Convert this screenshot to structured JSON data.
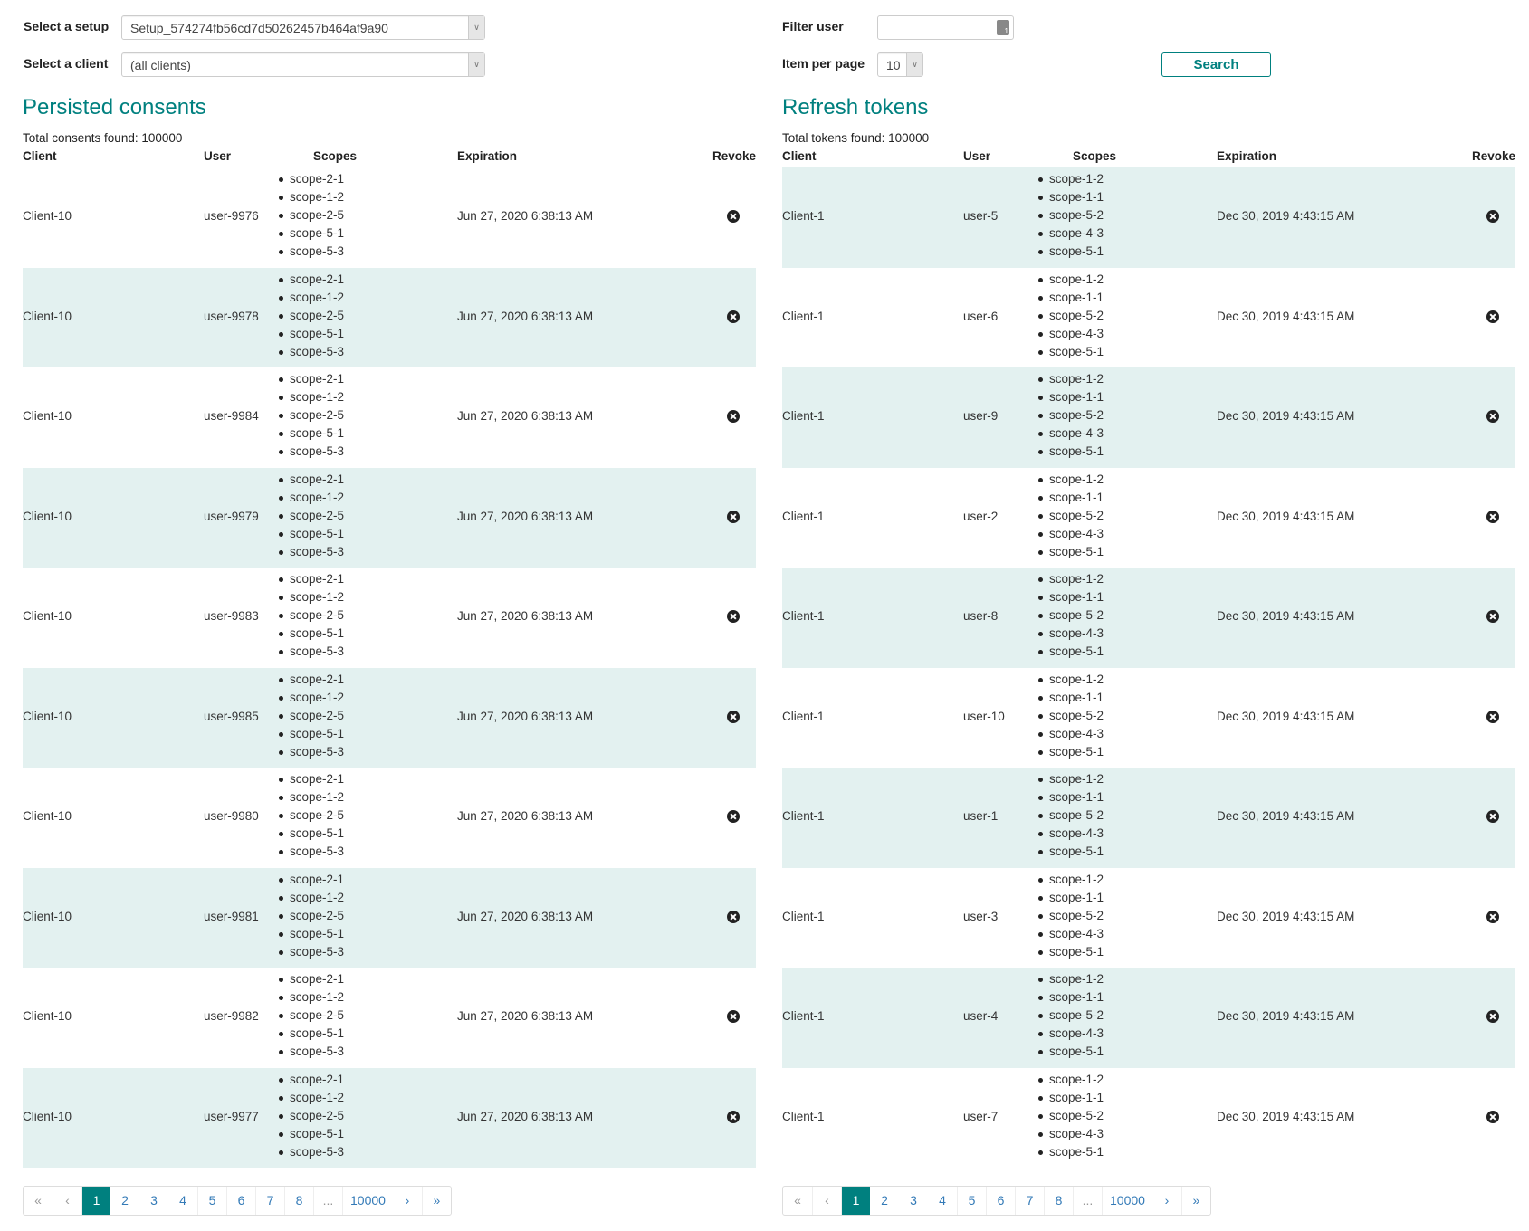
{
  "controls": {
    "setup_label": "Select a setup",
    "setup_value": "Setup_574274fb56cd7d50262457b464af9a90",
    "client_label": "Select a client",
    "client_value": "(all clients)",
    "filter_user_label": "Filter user",
    "filter_user_value": "",
    "item_per_page_label": "Item per page",
    "item_per_page_value": "10",
    "search_label": "Search"
  },
  "colors": {
    "accent": "#00807f",
    "row_shade": "#e3f1f0"
  },
  "consents": {
    "title": "Persisted consents",
    "total": "Total consents found: 100000",
    "headers": {
      "client": "Client",
      "user": "User",
      "scopes": "Scopes",
      "expiration": "Expiration",
      "revoke": "Revoke"
    },
    "rows": [
      {
        "client": "Client-10",
        "user": "user-9976",
        "scopes": [
          "scope-2-1",
          "scope-1-2",
          "scope-2-5",
          "scope-5-1",
          "scope-5-3"
        ],
        "expiration": "Jun 27, 2020 6:38:13 AM"
      },
      {
        "client": "Client-10",
        "user": "user-9978",
        "scopes": [
          "scope-2-1",
          "scope-1-2",
          "scope-2-5",
          "scope-5-1",
          "scope-5-3"
        ],
        "expiration": "Jun 27, 2020 6:38:13 AM"
      },
      {
        "client": "Client-10",
        "user": "user-9984",
        "scopes": [
          "scope-2-1",
          "scope-1-2",
          "scope-2-5",
          "scope-5-1",
          "scope-5-3"
        ],
        "expiration": "Jun 27, 2020 6:38:13 AM"
      },
      {
        "client": "Client-10",
        "user": "user-9979",
        "scopes": [
          "scope-2-1",
          "scope-1-2",
          "scope-2-5",
          "scope-5-1",
          "scope-5-3"
        ],
        "expiration": "Jun 27, 2020 6:38:13 AM"
      },
      {
        "client": "Client-10",
        "user": "user-9983",
        "scopes": [
          "scope-2-1",
          "scope-1-2",
          "scope-2-5",
          "scope-5-1",
          "scope-5-3"
        ],
        "expiration": "Jun 27, 2020 6:38:13 AM"
      },
      {
        "client": "Client-10",
        "user": "user-9985",
        "scopes": [
          "scope-2-1",
          "scope-1-2",
          "scope-2-5",
          "scope-5-1",
          "scope-5-3"
        ],
        "expiration": "Jun 27, 2020 6:38:13 AM"
      },
      {
        "client": "Client-10",
        "user": "user-9980",
        "scopes": [
          "scope-2-1",
          "scope-1-2",
          "scope-2-5",
          "scope-5-1",
          "scope-5-3"
        ],
        "expiration": "Jun 27, 2020 6:38:13 AM"
      },
      {
        "client": "Client-10",
        "user": "user-9981",
        "scopes": [
          "scope-2-1",
          "scope-1-2",
          "scope-2-5",
          "scope-5-1",
          "scope-5-3"
        ],
        "expiration": "Jun 27, 2020 6:38:13 AM"
      },
      {
        "client": "Client-10",
        "user": "user-9982",
        "scopes": [
          "scope-2-1",
          "scope-1-2",
          "scope-2-5",
          "scope-5-1",
          "scope-5-3"
        ],
        "expiration": "Jun 27, 2020 6:38:13 AM"
      },
      {
        "client": "Client-10",
        "user": "user-9977",
        "scopes": [
          "scope-2-1",
          "scope-1-2",
          "scope-2-5",
          "scope-5-1",
          "scope-5-3"
        ],
        "expiration": "Jun 27, 2020 6:38:13 AM"
      }
    ],
    "pagination": {
      "first": "«",
      "prev": "‹",
      "pages": [
        "1",
        "2",
        "3",
        "4",
        "5",
        "6",
        "7",
        "8"
      ],
      "ellipsis": "...",
      "last_page": "10000",
      "next": "›",
      "last": "»",
      "active": "1"
    }
  },
  "tokens": {
    "title": "Refresh tokens",
    "total": "Total tokens found: 100000",
    "headers": {
      "client": "Client",
      "user": "User",
      "scopes": "Scopes",
      "expiration": "Expiration",
      "revoke": "Revoke"
    },
    "rows": [
      {
        "client": "Client-1",
        "user": "user-5",
        "scopes": [
          "scope-1-2",
          "scope-1-1",
          "scope-5-2",
          "scope-4-3",
          "scope-5-1"
        ],
        "expiration": "Dec 30, 2019 4:43:15 AM"
      },
      {
        "client": "Client-1",
        "user": "user-6",
        "scopes": [
          "scope-1-2",
          "scope-1-1",
          "scope-5-2",
          "scope-4-3",
          "scope-5-1"
        ],
        "expiration": "Dec 30, 2019 4:43:15 AM"
      },
      {
        "client": "Client-1",
        "user": "user-9",
        "scopes": [
          "scope-1-2",
          "scope-1-1",
          "scope-5-2",
          "scope-4-3",
          "scope-5-1"
        ],
        "expiration": "Dec 30, 2019 4:43:15 AM"
      },
      {
        "client": "Client-1",
        "user": "user-2",
        "scopes": [
          "scope-1-2",
          "scope-1-1",
          "scope-5-2",
          "scope-4-3",
          "scope-5-1"
        ],
        "expiration": "Dec 30, 2019 4:43:15 AM"
      },
      {
        "client": "Client-1",
        "user": "user-8",
        "scopes": [
          "scope-1-2",
          "scope-1-1",
          "scope-5-2",
          "scope-4-3",
          "scope-5-1"
        ],
        "expiration": "Dec 30, 2019 4:43:15 AM"
      },
      {
        "client": "Client-1",
        "user": "user-10",
        "scopes": [
          "scope-1-2",
          "scope-1-1",
          "scope-5-2",
          "scope-4-3",
          "scope-5-1"
        ],
        "expiration": "Dec 30, 2019 4:43:15 AM"
      },
      {
        "client": "Client-1",
        "user": "user-1",
        "scopes": [
          "scope-1-2",
          "scope-1-1",
          "scope-5-2",
          "scope-4-3",
          "scope-5-1"
        ],
        "expiration": "Dec 30, 2019 4:43:15 AM"
      },
      {
        "client": "Client-1",
        "user": "user-3",
        "scopes": [
          "scope-1-2",
          "scope-1-1",
          "scope-5-2",
          "scope-4-3",
          "scope-5-1"
        ],
        "expiration": "Dec 30, 2019 4:43:15 AM"
      },
      {
        "client": "Client-1",
        "user": "user-4",
        "scopes": [
          "scope-1-2",
          "scope-1-1",
          "scope-5-2",
          "scope-4-3",
          "scope-5-1"
        ],
        "expiration": "Dec 30, 2019 4:43:15 AM"
      },
      {
        "client": "Client-1",
        "user": "user-7",
        "scopes": [
          "scope-1-2",
          "scope-1-1",
          "scope-5-2",
          "scope-4-3",
          "scope-5-1"
        ],
        "expiration": "Dec 30, 2019 4:43:15 AM"
      }
    ],
    "pagination": {
      "first": "«",
      "prev": "‹",
      "pages": [
        "1",
        "2",
        "3",
        "4",
        "5",
        "6",
        "7",
        "8"
      ],
      "ellipsis": "...",
      "last_page": "10000",
      "next": "›",
      "last": "»",
      "active": "1"
    }
  }
}
